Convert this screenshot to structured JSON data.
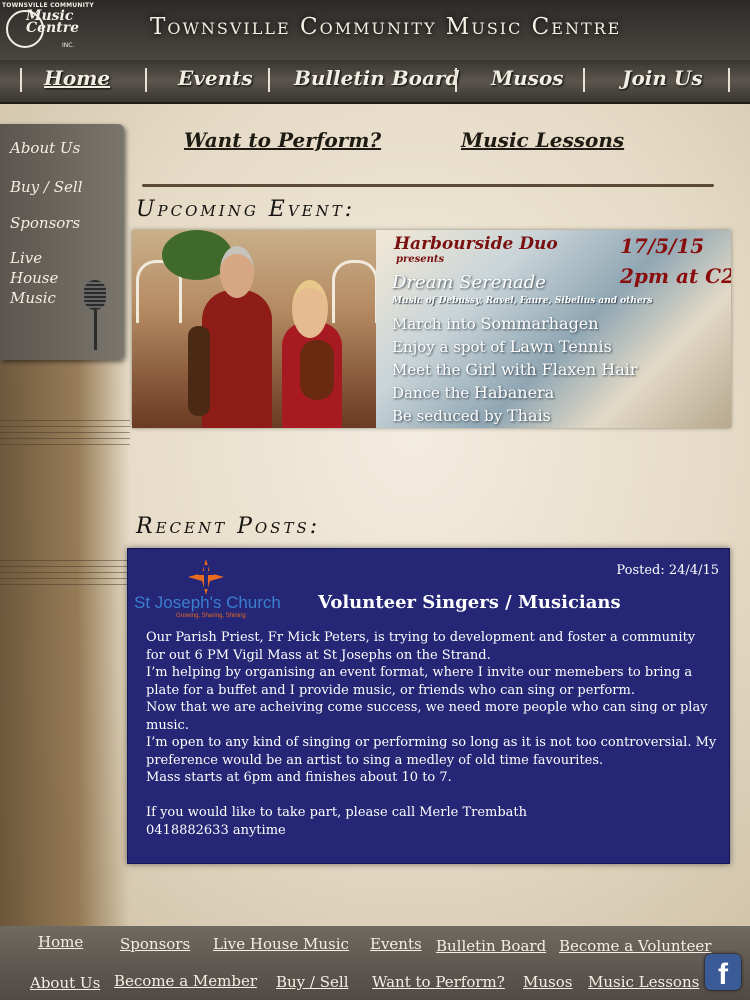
{
  "header": {
    "logo_small": "TOWNSVILLE COMMUNITY",
    "logo_script": "Music Centre",
    "logo_inc": "INC.",
    "title": "Townsville Community Music Centre"
  },
  "nav": {
    "items": [
      "Home",
      "Events",
      "Bulletin Board",
      "Musos",
      "Join Us"
    ],
    "active": "Home"
  },
  "sidebar": {
    "items": [
      "About Us",
      "Buy / Sell",
      "Sponsors",
      "Live House Music"
    ]
  },
  "top_links": {
    "perform": "Want to Perform?",
    "lessons": "Music Lessons"
  },
  "upcoming": {
    "heading": "Upcoming Event:",
    "artist": "Harbourside Duo",
    "presents": "presents",
    "date": "17/5/15",
    "time": "2pm at C2",
    "show": "Dream Serenade",
    "music": "Music of Debussy, Ravel, Faure, Sibelius and others",
    "lines": [
      {
        "pre": "March into ",
        "em": "Sommarhagen"
      },
      {
        "pre": "Enjoy a spot of ",
        "em": "Lawn Tennis"
      },
      {
        "pre": "Meet the ",
        "em": "Girl with Flaxen Hair"
      },
      {
        "pre": "Dance the ",
        "em": "Habanera"
      },
      {
        "pre": "Be seduced by ",
        "em": "Thais"
      }
    ]
  },
  "recent": {
    "heading": "Recent Posts:",
    "posted": "Posted: 24/4/15",
    "church_name": "St Joseph's Church",
    "church_tagline": "Growing, Sharing, Shining",
    "title": "Volunteer Singers / Musicians",
    "paragraphs": [
      "Our Parish Priest, Fr Mick Peters, is trying to development and foster a community for out 6 PM Vigil Mass at St Josephs on the Strand.",
      "I’m helping by organising an event format, where I invite our memebers to bring a plate for a buffet and I provide music, or friends who can sing or perform.",
      "Now that we are acheiving come success, we need more people who can sing or play music.",
      "I’m open to any kind of singing or performing so long as it is not too controversial. My preference would be an artist to sing a medley of old time favourites.",
      "Mass starts at 6pm and finishes about 10 to 7.",
      "",
      "If you would like to take part, please call Merle Trembath",
      "0418882633 anytime"
    ]
  },
  "footer": {
    "row1": [
      "Home",
      "Sponsors",
      "Live House Music",
      "Events",
      "Bulletin Board",
      "Become a Volunteer"
    ],
    "row2": [
      "About Us",
      "Become a Member",
      "Buy / Sell",
      "Want to Perform?",
      "Musos",
      "Music Lessons"
    ],
    "facebook_icon": "facebook-icon",
    "facebook_glyph": "f"
  }
}
